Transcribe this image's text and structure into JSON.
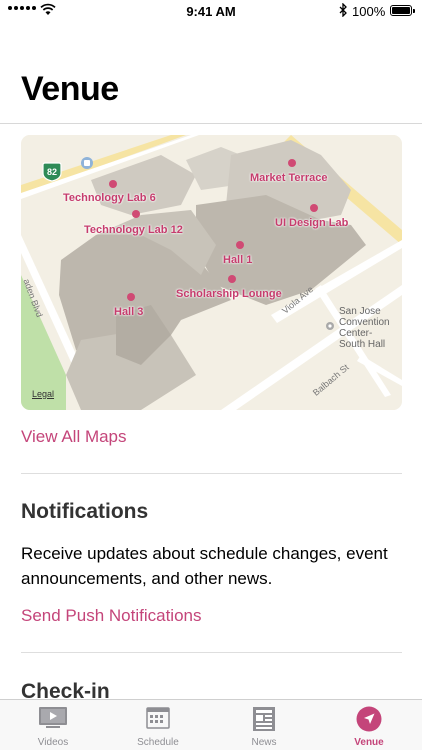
{
  "status_bar": {
    "time": "9:41 AM",
    "battery": "100%"
  },
  "page": {
    "title": "Venue"
  },
  "map": {
    "labels": {
      "market_terrace": "Market Terrace",
      "technology_lab_6": "Technology Lab 6",
      "technology_lab_12": "Technology Lab 12",
      "ui_design_lab": "UI Design Lab",
      "hall_1": "Hall 1",
      "scholarship_lounge": "Scholarship Lounge",
      "hall_3": "Hall 3"
    },
    "highway_shield": "82",
    "streets": {
      "viola": "Viola Ave",
      "balbach": "Balbach St",
      "blvd": "aden Blvd"
    },
    "poi": [
      "San Jose",
      "Convention",
      "Center-",
      "South Hall"
    ],
    "legal": "Legal"
  },
  "view_all_maps": "View All Maps",
  "notifications": {
    "heading": "Notifications",
    "body": "Receive updates about schedule changes, event announcements, and other news.",
    "action": "Send Push Notifications"
  },
  "checkin": {
    "heading": "Check-in"
  },
  "tabbar": {
    "active_color": "#c4457a",
    "inactive_color": "#8e8e93",
    "tabs": [
      {
        "label": "Videos",
        "icon": "video-icon"
      },
      {
        "label": "Schedule",
        "icon": "calendar-icon"
      },
      {
        "label": "News",
        "icon": "newspaper-icon"
      },
      {
        "label": "Venue",
        "icon": "location-arrow-icon"
      }
    ]
  }
}
